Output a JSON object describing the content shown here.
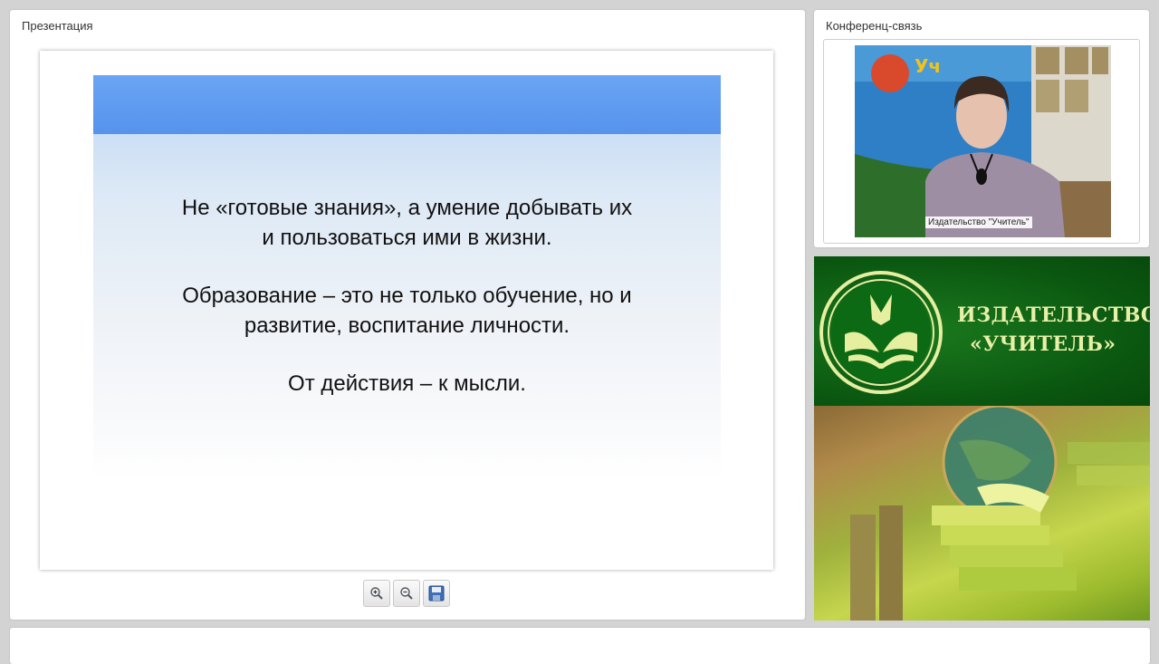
{
  "presentation": {
    "title": "Презентация",
    "slide": {
      "lines": [
        "Не «готовые знания», а умение добывать их",
        "и пользоваться ими в жизни.",
        "Образование – это не только обучение, но и",
        "развитие, воспитание личности.",
        "От действия – к мысли."
      ]
    },
    "toolbar": {
      "zoom_in_icon": "zoom-in-icon",
      "zoom_out_icon": "zoom-out-icon",
      "save_icon": "save-icon"
    }
  },
  "conference": {
    "title": "Конференц-связь",
    "video_label": "Издательство \"Учитель\""
  },
  "brand": {
    "line1": "ИЗДАТЕЛЬСТВО",
    "line2": "«УЧИТЕЛЬ»",
    "colors": {
      "banner": "#0a5610",
      "text": "#e8f0a8"
    }
  }
}
